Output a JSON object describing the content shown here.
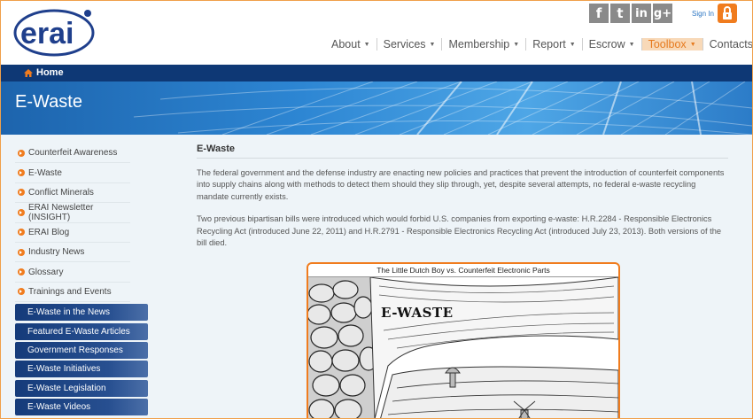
{
  "brand": {
    "logo_text": "erai"
  },
  "header": {
    "social_icons": [
      "facebook-icon",
      "twitter-icon",
      "linkedin-icon",
      "google-plus-icon"
    ],
    "social_glyphs": [
      "f",
      "t",
      "in",
      "g+"
    ],
    "signin_label": "Sign In"
  },
  "nav": {
    "items": [
      {
        "label": "About"
      },
      {
        "label": "Services"
      },
      {
        "label": "Membership"
      },
      {
        "label": "Report"
      },
      {
        "label": "Escrow"
      },
      {
        "label": "Toolbox",
        "active": true
      },
      {
        "label": "Contacts"
      }
    ]
  },
  "breadcrumb": {
    "home_label": "Home"
  },
  "banner": {
    "title": "E-Waste"
  },
  "sidebar": {
    "links": [
      "Counterfeit Awareness",
      "E-Waste",
      "Conflict Minerals",
      "ERAI Newsletter (INSIGHT)",
      "ERAI Blog",
      "Industry News",
      "Glossary",
      "Trainings and Events"
    ],
    "buttons": [
      "E-Waste in the News",
      "Featured E-Waste Articles",
      "Government Responses",
      "E-Waste Initiatives",
      "E-Waste Legislation",
      "E-Waste Videos"
    ]
  },
  "main": {
    "heading": "E-Waste",
    "paragraph1": "The federal government and the defense industry are enacting new policies and practices that prevent the introduction of counterfeit components into supply chains along with methods to detect them should they slip through, yet, despite several attempts, no federal e-waste recycling mandate currently exists.",
    "paragraph2": "Two previous bipartisan bills were introduced which would forbid U.S. companies from exporting e-waste: H.R.2284 - Responsible Electronics Recycling Act (introduced June 22, 2011) and H.R.2791 - Responsible Electronics Recycling Act (introduced July 23, 2013). Both versions of the bill died.",
    "cartoon": {
      "title": "The Little Dutch Boy vs. Counterfeit Electronic Parts",
      "label": "E-WASTE"
    }
  },
  "colors": {
    "accent": "#f07c1e",
    "navy": "#0e3875",
    "link": "#2f78c4"
  }
}
